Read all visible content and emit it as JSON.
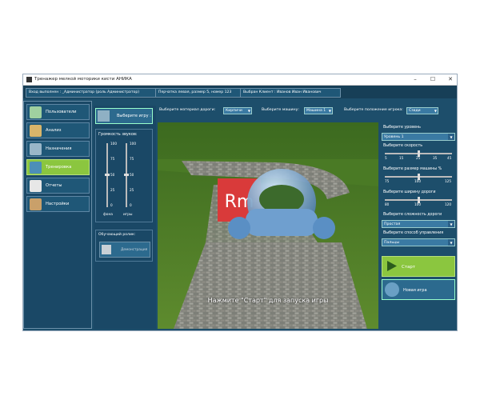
{
  "window": {
    "title": "Тренажер мелкой моторики кисти АНИКА",
    "controls": {
      "minimize": "–",
      "maximize": "☐",
      "close": "✕"
    }
  },
  "infobar": {
    "login": "Вход выполнен : _Администратор  (роль Администратор)",
    "glove": "Перчатка левая, размер 5, номер 123",
    "client": "Выбран Клиент : Иванов Иван Иванович"
  },
  "sidebar": {
    "items": [
      {
        "label": "Пользователи"
      },
      {
        "label": "Анализ"
      },
      {
        "label": "Назначения"
      },
      {
        "label": "Тренировка",
        "active": true
      },
      {
        "label": "Отчеты"
      },
      {
        "label": "Настройки"
      }
    ]
  },
  "game": {
    "select_label": "Выберите игру :"
  },
  "volume": {
    "title": "Громкость звуков:",
    "ticks": [
      "100",
      "75",
      "50",
      "25",
      "0"
    ],
    "background_label": "фона",
    "game_label": "игры"
  },
  "training": {
    "title": "Обучающий ролик:",
    "demo_label": "Демонстрация"
  },
  "top": {
    "material_label": "Выберите материал дороги:",
    "material_value": "Кирпичи",
    "car_label": "Выберите машину:",
    "car_value": "Машина 1",
    "position_label": "Выберите положение игрока:",
    "position_value": "Сзади"
  },
  "scene": {
    "message": "Нажмите \"Старт\" для запуска игры",
    "logo": "Rm"
  },
  "right": {
    "level_label": "Выберите уровень",
    "level_value": "Уровень 1",
    "speed_label": "Выберите скорость",
    "speed_ticks": [
      "5",
      "15",
      "25",
      "35",
      "45"
    ],
    "speed_value": 25,
    "size_label": "Выберите размер машины %",
    "size_ticks": [
      "75",
      "100",
      "125"
    ],
    "size_value": 100,
    "width_label": "Выберите ширину дороги",
    "width_ticks": [
      "80",
      "100",
      "120"
    ],
    "width_value": 100,
    "difficulty_label": "Выберите сложность дороги",
    "difficulty_value": "Простая",
    "control_label": "Выберите способ управления",
    "control_value": "Пальцы",
    "start_label": "Старт",
    "newgame_label": "Новая игра"
  },
  "colors": {
    "panel": "#1d4e6b",
    "active": "#8bc63f",
    "accent_red": "#d93a3a"
  }
}
